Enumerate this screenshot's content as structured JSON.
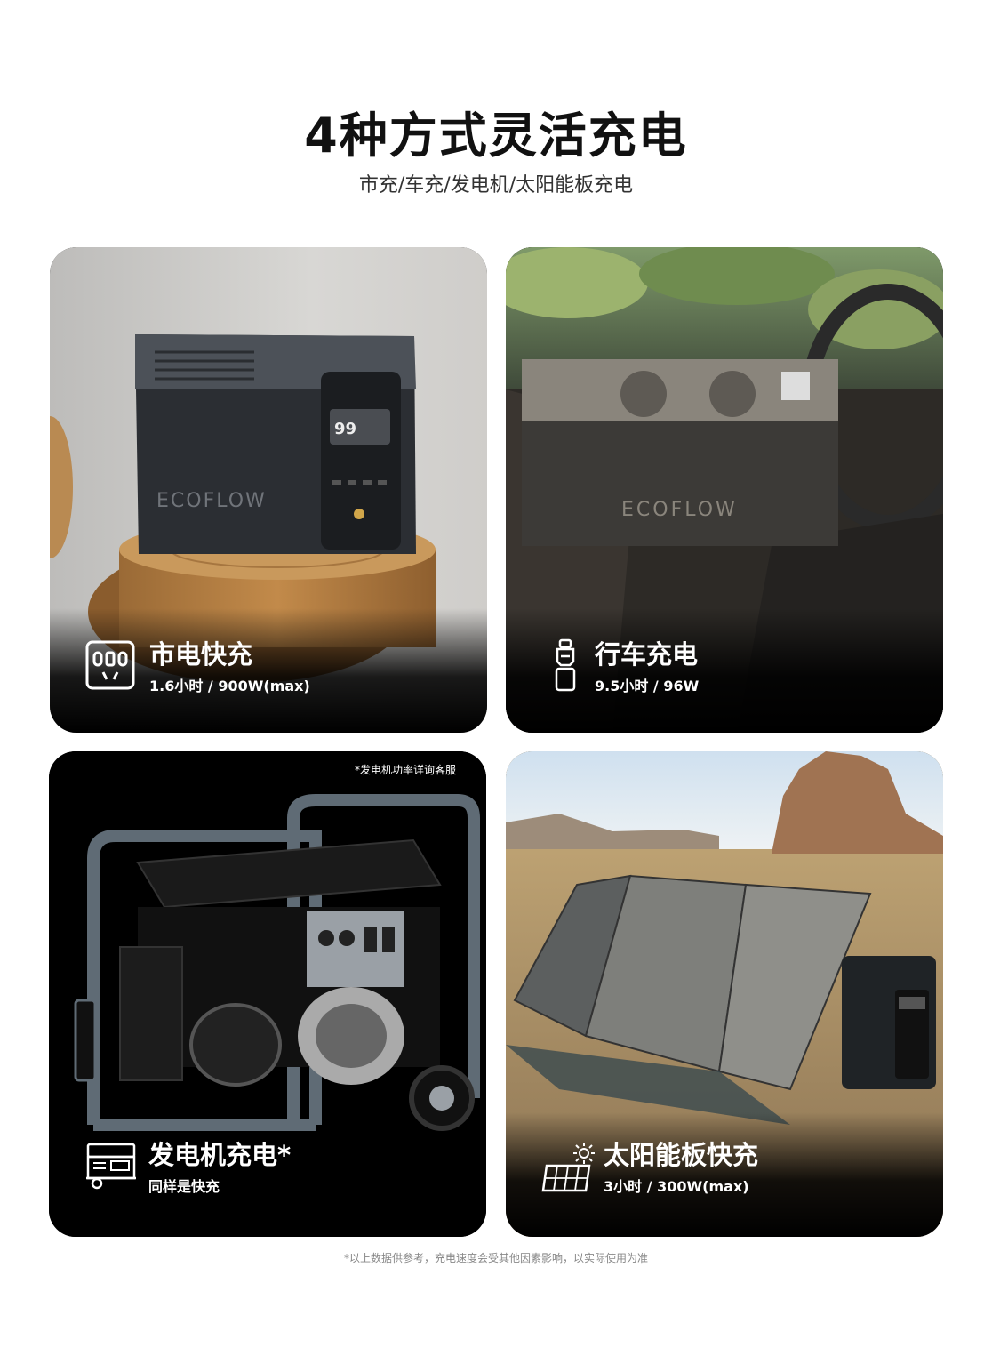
{
  "header": {
    "title": "4种方式灵活充电",
    "subtitle": "市充/车充/发电机/太阳能板充电"
  },
  "cards": [
    {
      "title": "市电快充",
      "subtitle": "1.6小时 / 900W(max)",
      "icon": "wall-outlet-icon",
      "brand": "ECOFLOW",
      "display": "99"
    },
    {
      "title": "行车充电",
      "subtitle": "9.5小时 / 96W",
      "icon": "car-charger-icon",
      "brand": "ECOFLOW"
    },
    {
      "title": "发电机充电*",
      "subtitle": "同样是快充",
      "icon": "generator-icon",
      "note": "*发电机功率详询客服"
    },
    {
      "title": "太阳能板快充",
      "subtitle": "3小时 / 300W(max)",
      "icon": "solar-panel-icon",
      "sun_icon": "sun-icon"
    }
  ],
  "footnote": "*以上数据供参考，充电速度会受其他因素影响，以实际使用为准"
}
